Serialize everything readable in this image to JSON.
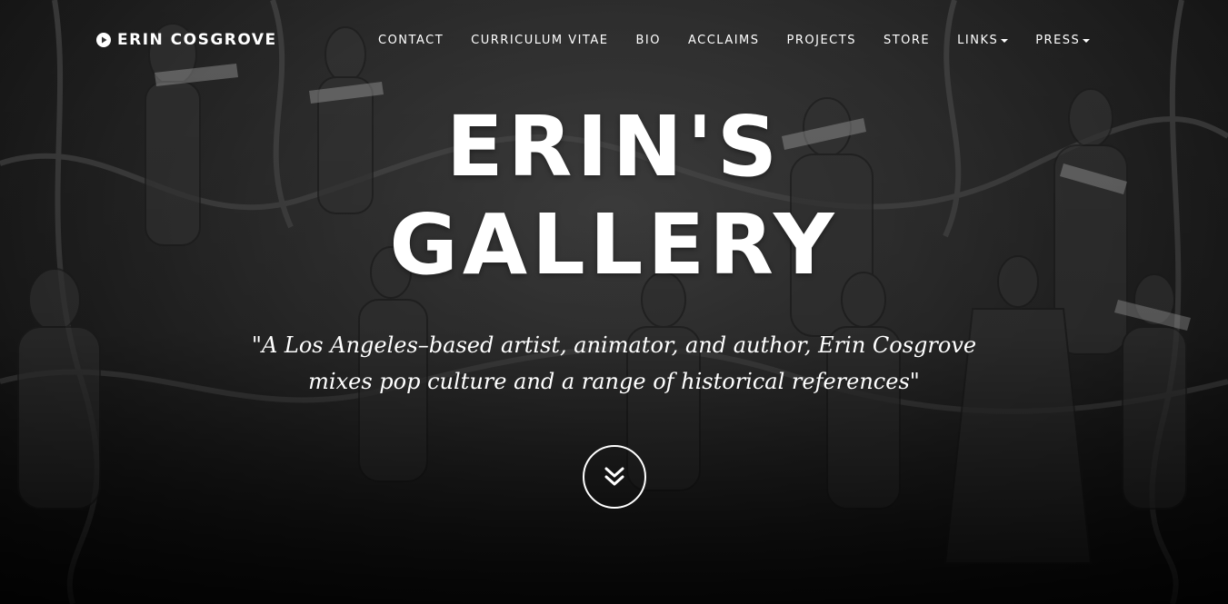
{
  "brand": {
    "name": "ERIN COSGROVE",
    "icon": "play-circle-icon"
  },
  "nav": [
    {
      "label": "CONTACT",
      "dropdown": false
    },
    {
      "label": "CURRICULUM VITAE",
      "dropdown": false
    },
    {
      "label": "BIO",
      "dropdown": false
    },
    {
      "label": "ACCLAIMS",
      "dropdown": false
    },
    {
      "label": "PROJECTS",
      "dropdown": false
    },
    {
      "label": "STORE",
      "dropdown": false
    },
    {
      "label": "LINKS",
      "dropdown": true
    },
    {
      "label": "PRESS",
      "dropdown": true
    }
  ],
  "hero": {
    "title_line1": "ERIN'S",
    "title_line2": "GALLERY",
    "quote_line1": "\"A Los Angeles–based artist, animator, and author, Erin Cosgrove",
    "quote_line2": "mixes pop culture and a range of historical references\"",
    "scroll_icon": "double-chevron-down-icon"
  },
  "colors": {
    "text": "#ffffff",
    "background": "#2e2e2e"
  }
}
